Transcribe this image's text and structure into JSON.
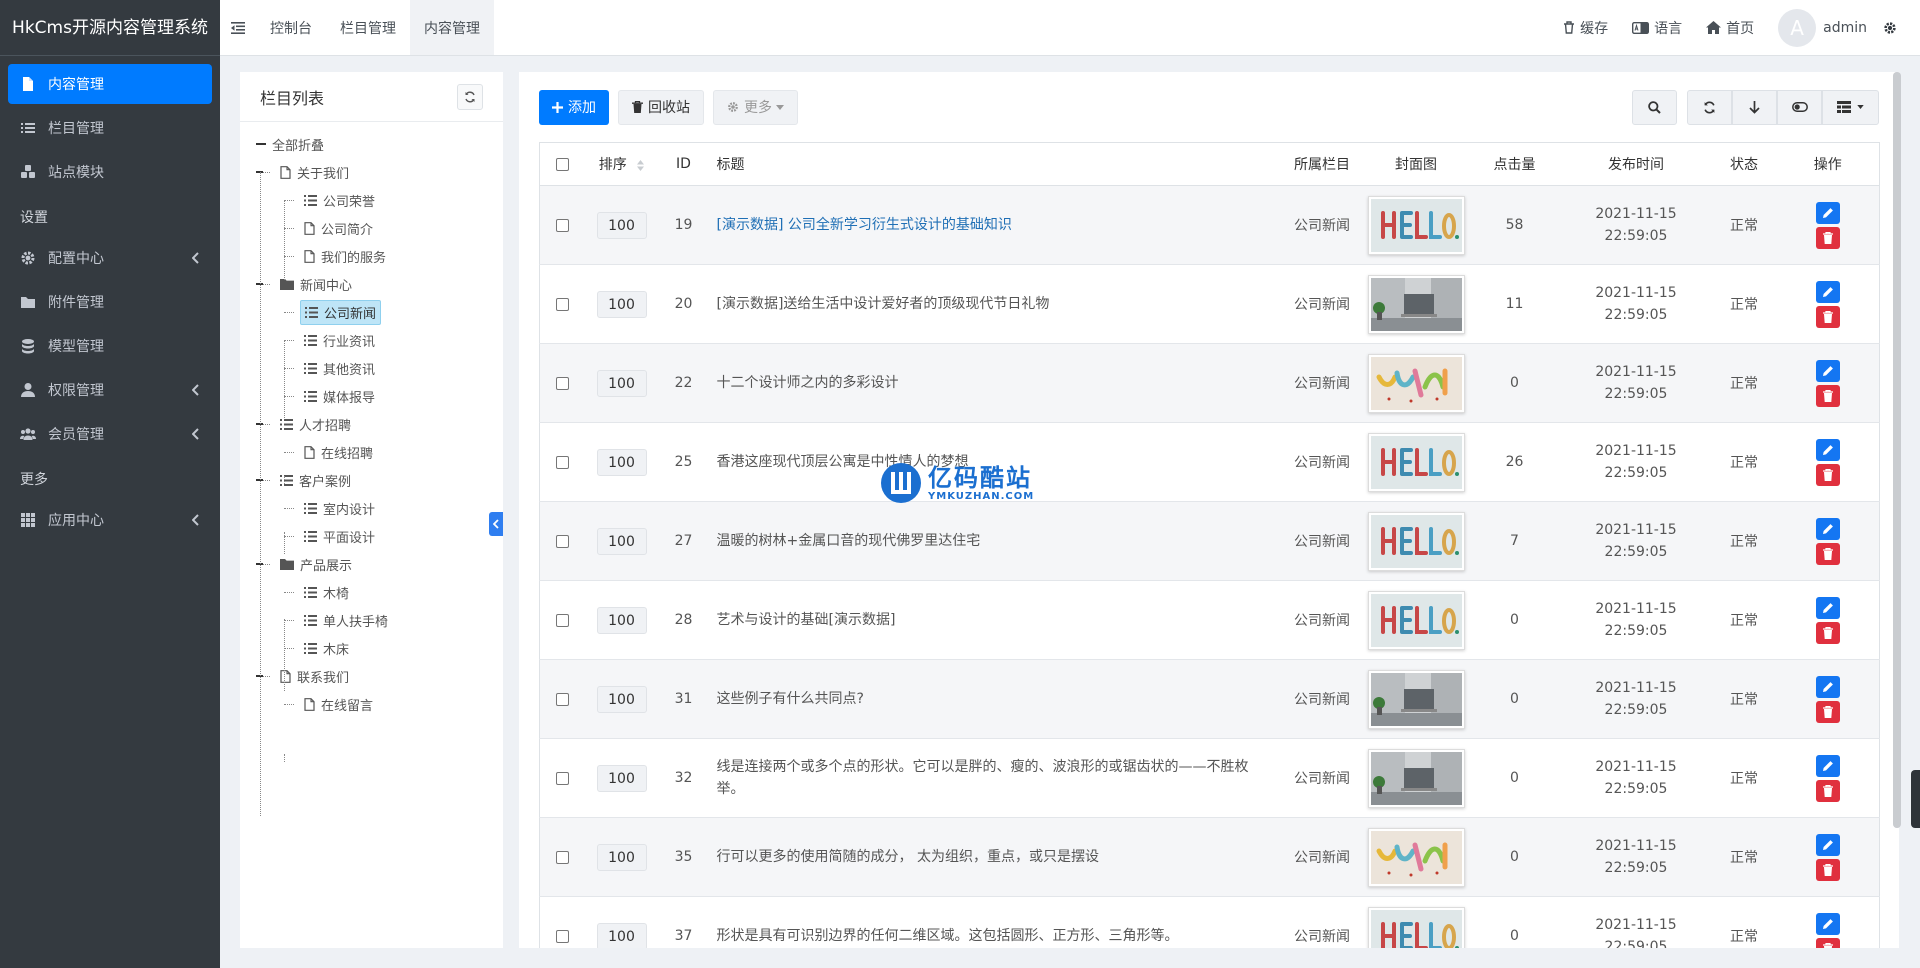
{
  "app": {
    "title": "HkCms开源内容管理系统"
  },
  "sidebar": {
    "items": [
      {
        "label": "内容管理",
        "icon": "file-icon",
        "active": true
      },
      {
        "label": "栏目管理",
        "icon": "list-icon"
      },
      {
        "label": "站点模块",
        "icon": "cubes-icon"
      }
    ],
    "settings_header": "设置",
    "settings_items": [
      {
        "label": "配置中心",
        "icon": "gear-icon",
        "has_children": true
      },
      {
        "label": "附件管理",
        "icon": "folder-icon"
      },
      {
        "label": "模型管理",
        "icon": "database-icon"
      },
      {
        "label": "权限管理",
        "icon": "user-icon",
        "has_children": true
      },
      {
        "label": "会员管理",
        "icon": "users-icon",
        "has_children": true
      }
    ],
    "more_header": "更多",
    "more_items": [
      {
        "label": "应用中心",
        "icon": "grid-icon",
        "has_children": true
      }
    ]
  },
  "topbar": {
    "tabs": [
      "控制台",
      "栏目管理",
      "内容管理"
    ],
    "active_tab": "内容管理",
    "right": {
      "cache": "缓存",
      "language": "语言",
      "home": "首页",
      "avatar_letter": "A",
      "user": "admin"
    }
  },
  "tree": {
    "title": "栏目列表",
    "root": "全部折叠",
    "nodes": [
      {
        "label": "关于我们",
        "type": "page",
        "level": 1
      },
      {
        "label": "公司荣誉",
        "type": "list",
        "level": 2
      },
      {
        "label": "公司简介",
        "type": "page",
        "level": 2
      },
      {
        "label": "我们的服务",
        "type": "page",
        "level": 2
      },
      {
        "label": "新闻中心",
        "type": "folder",
        "level": 1
      },
      {
        "label": "公司新闻",
        "type": "list",
        "level": 2,
        "selected": true
      },
      {
        "label": "行业资讯",
        "type": "list",
        "level": 2
      },
      {
        "label": "其他资讯",
        "type": "list",
        "level": 2
      },
      {
        "label": "媒体报导",
        "type": "list",
        "level": 2
      },
      {
        "label": "人才招聘",
        "type": "list",
        "level": 1
      },
      {
        "label": "在线招聘",
        "type": "page",
        "level": 2
      },
      {
        "label": "客户案例",
        "type": "list",
        "level": 1
      },
      {
        "label": "室内设计",
        "type": "list",
        "level": 2
      },
      {
        "label": "平面设计",
        "type": "list",
        "level": 2
      },
      {
        "label": "产品展示",
        "type": "folder",
        "level": 1
      },
      {
        "label": "木椅",
        "type": "list",
        "level": 2
      },
      {
        "label": "单人扶手椅",
        "type": "list",
        "level": 2
      },
      {
        "label": "木床",
        "type": "list",
        "level": 2
      },
      {
        "label": "联系我们",
        "type": "page",
        "level": 1
      },
      {
        "label": "在线留言",
        "type": "page",
        "level": 2
      }
    ]
  },
  "toolbar": {
    "add": "添加",
    "recycle": "回收站",
    "more": "更多"
  },
  "table": {
    "columns": [
      "排序",
      "ID",
      "标题",
      "所属栏目",
      "封面图",
      "点击量",
      "发布时间",
      "状态",
      "操作"
    ],
    "rows": [
      {
        "sort": "100",
        "id": "19",
        "title": "[演示数据] 公司全新学习衍生式设计的基础知识",
        "category": "公司新闻",
        "cover": "hello",
        "views": "58",
        "date": "2021-11-15",
        "time": "22:59:05",
        "status": "正常",
        "link": true
      },
      {
        "sort": "100",
        "id": "20",
        "title": "[演示数据]送给生活中设计爱好者的顶级现代节日礼物",
        "category": "公司新闻",
        "cover": "desk",
        "views": "11",
        "date": "2021-11-15",
        "time": "22:59:05",
        "status": "正常"
      },
      {
        "sort": "100",
        "id": "22",
        "title": "十二个设计师之内的多彩设计",
        "category": "公司新闻",
        "cover": "color",
        "views": "0",
        "date": "2021-11-15",
        "time": "22:59:05",
        "status": "正常"
      },
      {
        "sort": "100",
        "id": "25",
        "title": "香港这座现代顶层公寓是中性情人的梦想",
        "category": "公司新闻",
        "cover": "hello",
        "views": "26",
        "date": "2021-11-15",
        "time": "22:59:05",
        "status": "正常"
      },
      {
        "sort": "100",
        "id": "27",
        "title": "温暖的树林+金属口音的现代佛罗里达住宅",
        "category": "公司新闻",
        "cover": "hello",
        "views": "7",
        "date": "2021-11-15",
        "time": "22:59:05",
        "status": "正常"
      },
      {
        "sort": "100",
        "id": "28",
        "title": "艺术与设计的基础[演示数据]",
        "category": "公司新闻",
        "cover": "hello",
        "views": "0",
        "date": "2021-11-15",
        "time": "22:59:05",
        "status": "正常"
      },
      {
        "sort": "100",
        "id": "31",
        "title": "这些例子有什么共同点?",
        "category": "公司新闻",
        "cover": "desk",
        "views": "0",
        "date": "2021-11-15",
        "time": "22:59:05",
        "status": "正常"
      },
      {
        "sort": "100",
        "id": "32",
        "title": "线是连接两个或多个点的形状。它可以是胖的、瘦的、波浪形的或锯齿状的——不胜枚举。",
        "category": "公司新闻",
        "cover": "desk",
        "views": "0",
        "date": "2021-11-15",
        "time": "22:59:05",
        "status": "正常"
      },
      {
        "sort": "100",
        "id": "35",
        "title": "行可以更多的使用简随的成分， 太为组织，重点，或只是摆设",
        "category": "公司新闻",
        "cover": "color",
        "views": "0",
        "date": "2021-11-15",
        "time": "22:59:05",
        "status": "正常"
      },
      {
        "sort": "100",
        "id": "37",
        "title": "形状是具有可识别边界的任何二维区域。这包括圆形、正方形、三角形等。",
        "category": "公司新闻",
        "cover": "hello",
        "views": "0",
        "date": "2021-11-15",
        "time": "22:59:05",
        "status": "正常"
      }
    ]
  },
  "watermark": {
    "main": "亿码酷站",
    "sub": "YMKUZHAN.COM"
  },
  "colors": {
    "primary": "#007bff",
    "danger": "#e0303e",
    "sidebar": "#343a40"
  }
}
